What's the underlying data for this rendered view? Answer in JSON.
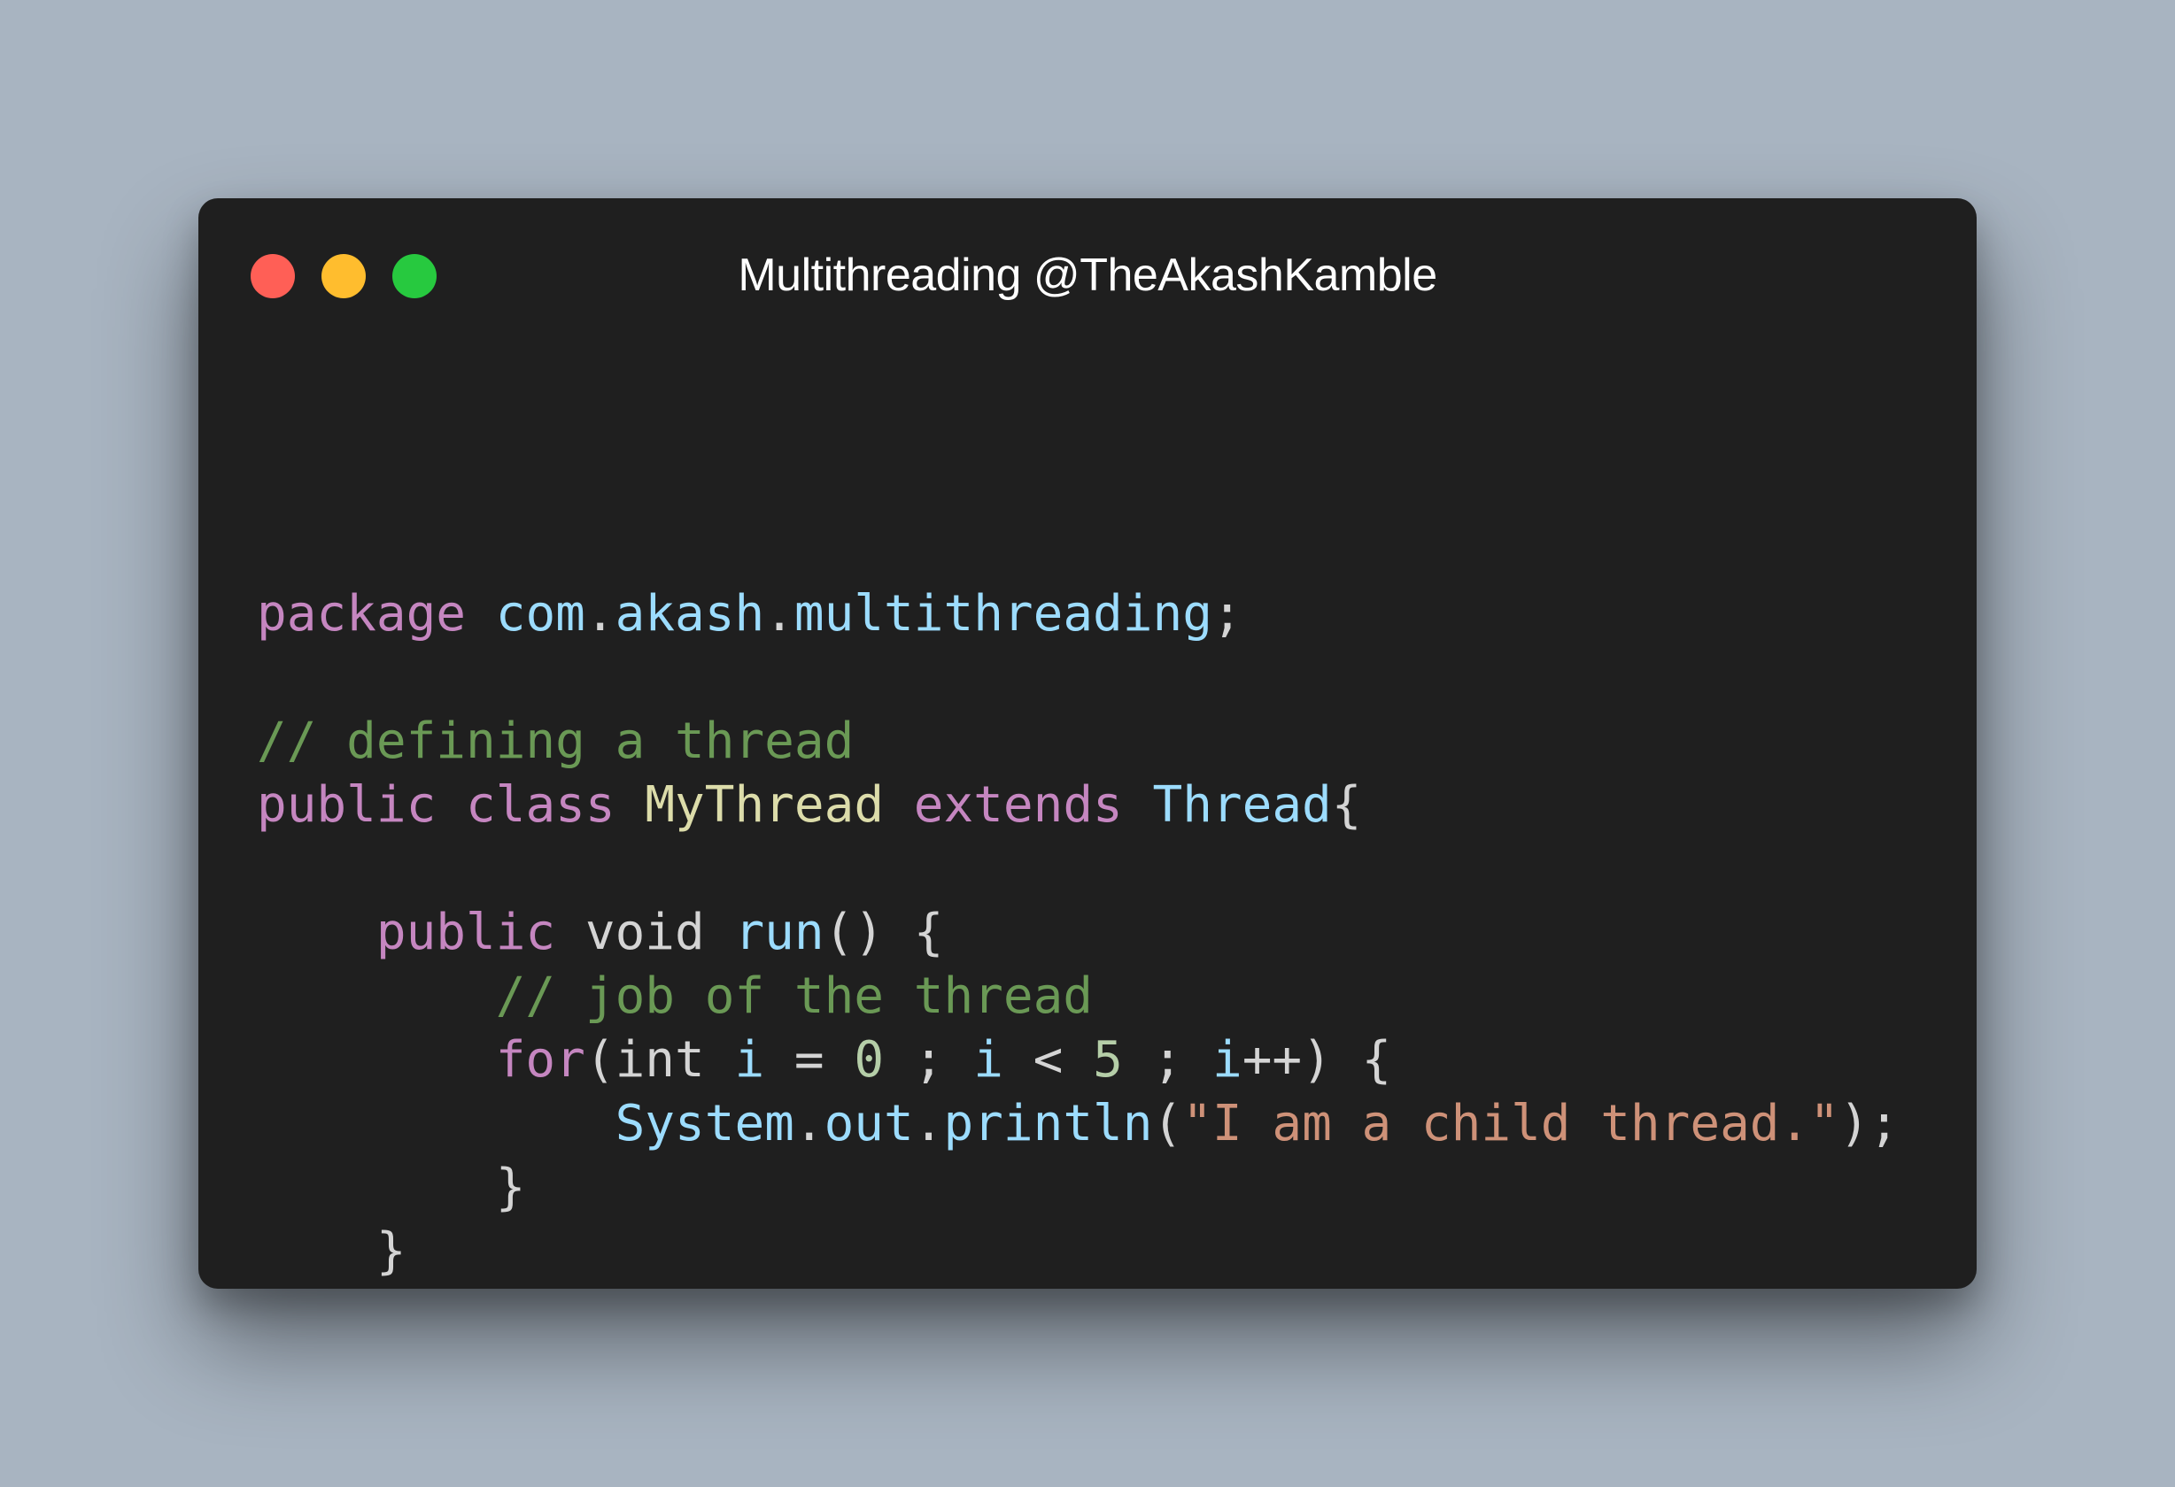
{
  "window": {
    "title": "Multithreading @TheAkashKamble",
    "controls": [
      {
        "name": "close",
        "color": "#ff5f56"
      },
      {
        "name": "minimize",
        "color": "#ffbd2e"
      },
      {
        "name": "maximize",
        "color": "#27c93f"
      }
    ]
  },
  "colors": {
    "background": "#a8b4c1",
    "window": "#1f1f1f",
    "keyword": "#c586c0",
    "type_name": "#dcdcaa",
    "identifier": "#9cdcfe",
    "comment": "#6a9955",
    "string": "#ce9178",
    "number": "#b5cea8",
    "plain": "#d4d4d4"
  },
  "code": {
    "lines": [
      [
        {
          "t": "package",
          "k": "keyword"
        },
        {
          "t": " ",
          "k": "plain"
        },
        {
          "t": "com",
          "k": "identifier"
        },
        {
          "t": ".",
          "k": "plain"
        },
        {
          "t": "akash",
          "k": "identifier"
        },
        {
          "t": ".",
          "k": "plain"
        },
        {
          "t": "multithreading",
          "k": "identifier"
        },
        {
          "t": ";",
          "k": "plain"
        }
      ],
      [],
      [
        {
          "t": "// defining a thread",
          "k": "comment"
        }
      ],
      [
        {
          "t": "public",
          "k": "keyword"
        },
        {
          "t": " ",
          "k": "plain"
        },
        {
          "t": "class",
          "k": "keyword"
        },
        {
          "t": " ",
          "k": "plain"
        },
        {
          "t": "MyThread",
          "k": "type_name"
        },
        {
          "t": " ",
          "k": "plain"
        },
        {
          "t": "extends",
          "k": "keyword"
        },
        {
          "t": " ",
          "k": "plain"
        },
        {
          "t": "Thread",
          "k": "identifier"
        },
        {
          "t": "{",
          "k": "plain"
        }
      ],
      [],
      [
        {
          "t": "    ",
          "k": "plain"
        },
        {
          "t": "public",
          "k": "keyword"
        },
        {
          "t": " ",
          "k": "plain"
        },
        {
          "t": "void",
          "k": "plain"
        },
        {
          "t": " ",
          "k": "plain"
        },
        {
          "t": "run",
          "k": "identifier"
        },
        {
          "t": "() {",
          "k": "plain"
        }
      ],
      [
        {
          "t": "        ",
          "k": "plain"
        },
        {
          "t": "// job of the thread",
          "k": "comment"
        }
      ],
      [
        {
          "t": "        ",
          "k": "plain"
        },
        {
          "t": "for",
          "k": "keyword"
        },
        {
          "t": "(",
          "k": "plain"
        },
        {
          "t": "int",
          "k": "plain"
        },
        {
          "t": " ",
          "k": "plain"
        },
        {
          "t": "i",
          "k": "identifier"
        },
        {
          "t": " = ",
          "k": "plain"
        },
        {
          "t": "0",
          "k": "number"
        },
        {
          "t": " ; ",
          "k": "plain"
        },
        {
          "t": "i",
          "k": "identifier"
        },
        {
          "t": " < ",
          "k": "plain"
        },
        {
          "t": "5",
          "k": "number"
        },
        {
          "t": " ; ",
          "k": "plain"
        },
        {
          "t": "i",
          "k": "identifier"
        },
        {
          "t": "++) {",
          "k": "plain"
        }
      ],
      [
        {
          "t": "            ",
          "k": "plain"
        },
        {
          "t": "System",
          "k": "identifier"
        },
        {
          "t": ".",
          "k": "plain"
        },
        {
          "t": "out",
          "k": "identifier"
        },
        {
          "t": ".",
          "k": "plain"
        },
        {
          "t": "println",
          "k": "identifier"
        },
        {
          "t": "(",
          "k": "plain"
        },
        {
          "t": "\"I am a child thread.\"",
          "k": "string"
        },
        {
          "t": ");",
          "k": "plain"
        }
      ],
      [
        {
          "t": "        }",
          "k": "plain"
        }
      ],
      [
        {
          "t": "    }",
          "k": "plain"
        }
      ],
      [
        {
          "t": "}",
          "k": "plain"
        }
      ]
    ]
  }
}
